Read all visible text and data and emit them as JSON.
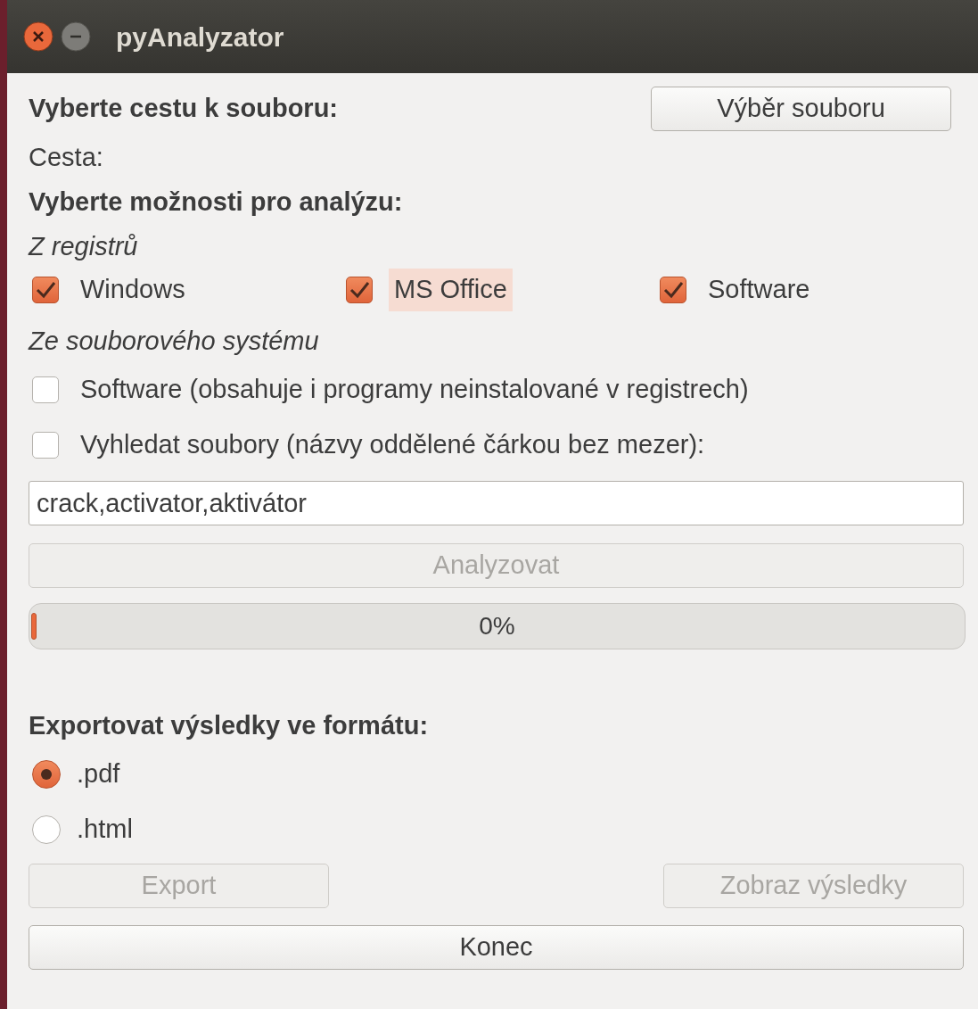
{
  "window": {
    "title": "pyAnalyzator"
  },
  "file_section": {
    "heading": "Vyberte cestu k souboru:",
    "button": {
      "label": "Výběr souboru",
      "disabled": false
    },
    "path_label": "Cesta:"
  },
  "options": {
    "heading": "Vyberte možnosti pro analýzu:",
    "groups": [
      {
        "title": "Z registrů",
        "kind": "row",
        "items": [
          {
            "label": "Windows",
            "checked": true,
            "focused": false
          },
          {
            "label": "MS Office",
            "checked": true,
            "focused": true
          },
          {
            "label": "Software",
            "checked": true,
            "focused": false
          }
        ]
      },
      {
        "title": "Ze souborového systému",
        "kind": "column",
        "items": [
          {
            "label": "Software (obsahuje i programy neinstalované v registrech)",
            "checked": false,
            "focused": false
          },
          {
            "label": "Vyhledat soubory (názvy oddělené čárkou bez mezer):",
            "checked": false,
            "focused": false
          }
        ]
      }
    ]
  },
  "search_field": {
    "value": "crack,activator,aktivátor"
  },
  "analyze_button": {
    "label": "Analyzovat",
    "disabled": true
  },
  "progress": {
    "level": 0,
    "reading": "0%"
  },
  "export": {
    "heading": "Exportovat výsledky ve formátu:",
    "formats": [
      {
        "label": ".pdf",
        "selected": true
      },
      {
        "label": ".html",
        "selected": false
      }
    ],
    "buttons": [
      {
        "label": "Export",
        "disabled": true
      },
      {
        "label": "Zobraz výsledky",
        "disabled": true
      }
    ]
  },
  "quit_button": {
    "label": "Konec",
    "disabled": false
  }
}
